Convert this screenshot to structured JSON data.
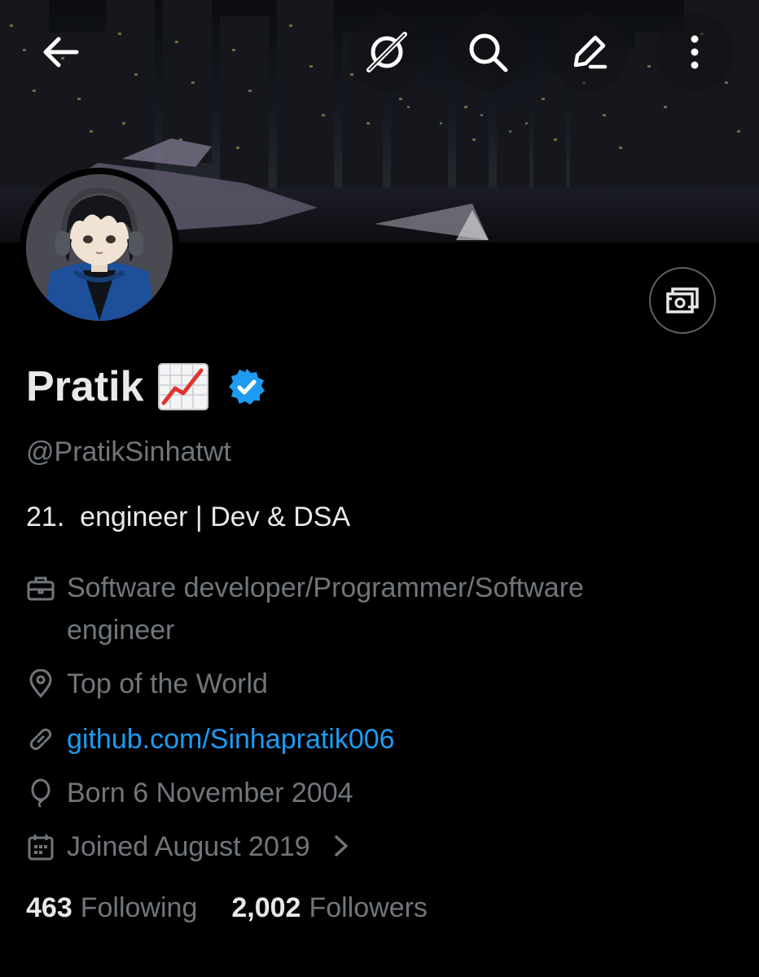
{
  "header": {
    "back_icon": "arrow-left-icon",
    "actions": [
      "grok-icon",
      "search-icon",
      "edit-icon",
      "more-vertical-icon"
    ]
  },
  "profile": {
    "name": "Pratik",
    "name_emoji_icon": "chart-increasing-emoji",
    "verified_icon": "verified-badge-icon",
    "handle": "@PratikSinhatwt",
    "bio": "21.  engineer | Dev & DSA",
    "tip_icon": "money-icon"
  },
  "meta": {
    "profession": "Software developer/Programmer/Software engineer",
    "profession_line1": "Software developer/Programmer/Software",
    "profession_line2": "engineer",
    "location": "Top of the World",
    "website": "github.com/Sinhapratik006",
    "birthday": "Born 6 November 2004",
    "joined": "Joined August 2019"
  },
  "stats": {
    "following_count": "463",
    "following_label": "Following",
    "followers_count": "2,002",
    "followers_label": "Followers"
  },
  "colors": {
    "background": "#000000",
    "primary_text": "#e7e9ea",
    "secondary_text": "#71767b",
    "accent": "#1d9bf0"
  }
}
